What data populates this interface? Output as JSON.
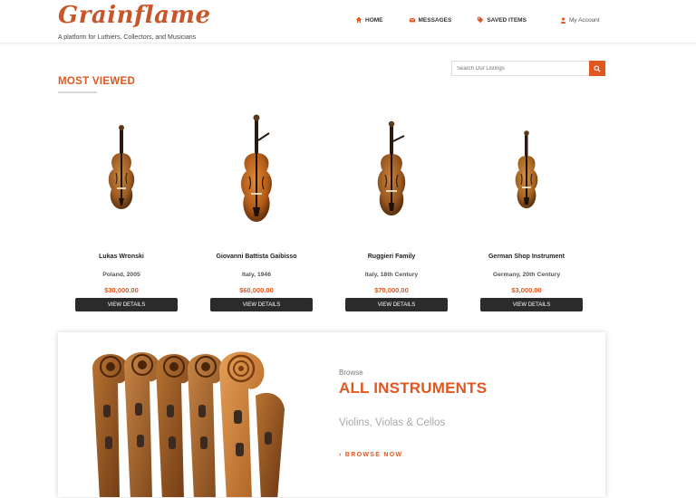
{
  "header": {
    "logo": "Grainflame",
    "tagline": "A platform for Luthiers, Collectors, and Musicians",
    "nav": [
      {
        "label": "HOME",
        "icon": "home-icon"
      },
      {
        "label": "MESSAGES",
        "icon": "envelope-icon"
      },
      {
        "label": "SAVED ITEMS",
        "icon": "tag-icon"
      }
    ],
    "account": {
      "label": "My Account",
      "icon": "user-icon"
    }
  },
  "search": {
    "placeholder": "Search Our Listings",
    "icon": "search-icon"
  },
  "section": {
    "title": "MOST VIEWED"
  },
  "listings": [
    {
      "name": "Lukas Wronski",
      "origin": "Poland, 2005",
      "price": "$30,000.00",
      "button": "VIEW DETAILS"
    },
    {
      "name": "Giovanni Battista Gaibisso",
      "origin": "Italy, 1946",
      "price": "$60,000.00",
      "button": "VIEW DETAILS"
    },
    {
      "name": "Ruggieri Family",
      "origin": "Italy, 18th Century",
      "price": "$70,000.00",
      "button": "VIEW DETAILS"
    },
    {
      "name": "German Shop Instrument",
      "origin": "Germany, 20th Century",
      "price": "$3,000.00",
      "button": "VIEW DETAILS"
    }
  ],
  "banner": {
    "browse": "Browse",
    "title": "ALL INSTRUMENTS",
    "subtitle": "Violins, Violas & Cellos",
    "cta": "› BROWSE NOW"
  },
  "colors": {
    "accent": "#e2561f",
    "button": "#2b2b2b",
    "logo": "#c8562b"
  }
}
